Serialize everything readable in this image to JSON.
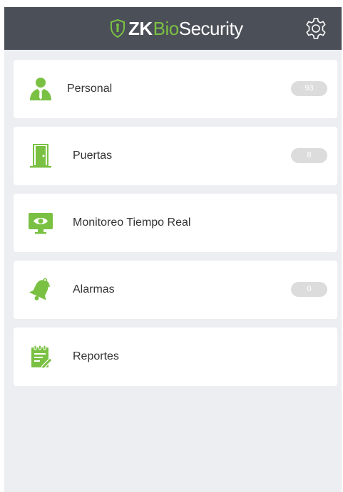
{
  "header": {
    "logo_zk": "ZK",
    "logo_bio": "Bio",
    "logo_security": "Security",
    "settings_icon": "gear-icon"
  },
  "colors": {
    "header_bg": "#4b4f57",
    "accent_green": "#7ac143",
    "page_bg": "#eceef2",
    "badge_bg": "#dcdcdc"
  },
  "menu": {
    "items": [
      {
        "label": "Personal",
        "icon": "person-icon",
        "badge": "93"
      },
      {
        "label": "Puertas",
        "icon": "door-icon",
        "badge": "8"
      },
      {
        "label": "Monitoreo Tiempo Real",
        "icon": "monitor-eye-icon"
      },
      {
        "label": "Alarmas",
        "icon": "bell-icon",
        "badge": "0"
      },
      {
        "label": "Reportes",
        "icon": "report-icon"
      }
    ]
  }
}
